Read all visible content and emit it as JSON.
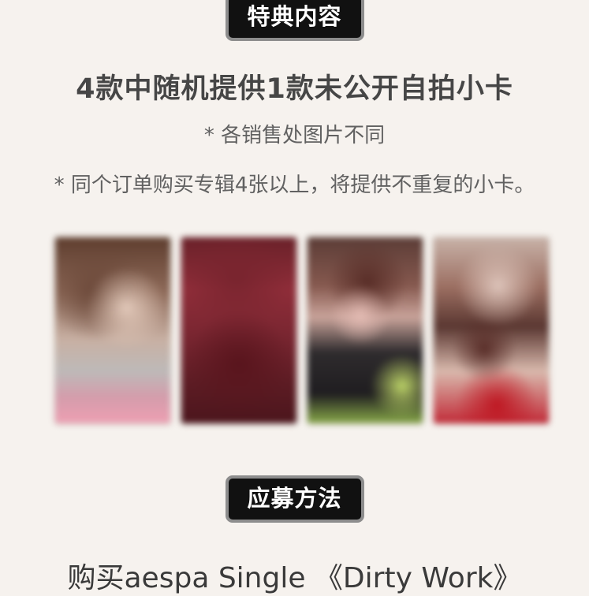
{
  "sections": {
    "benefit_title": "特典内容",
    "method_title": "应募方法"
  },
  "content": {
    "headline": "4款中随机提供1款未公开自拍小卡",
    "note_1": "* 各销售处图片不同",
    "note_2": "* 同个订单购买专辑4张以上，将提供不重复的小卡。",
    "bottom_text": "购买aespa Single 《Dirty Work》"
  },
  "colors": {
    "page_background": "#f6f2ee",
    "badge_background": "#111111",
    "badge_border": "#8d8d8d",
    "text_primary": "#464646",
    "text_secondary": "#616161"
  }
}
